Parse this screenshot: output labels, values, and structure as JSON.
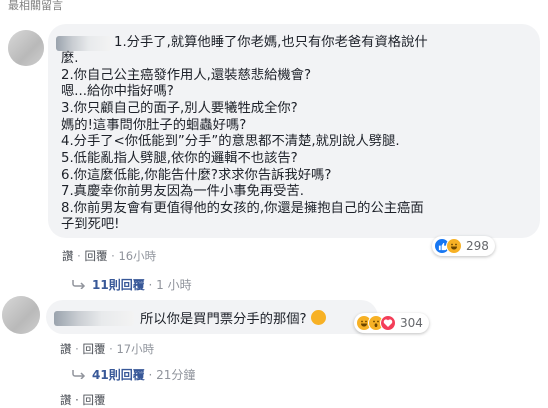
{
  "section_header": "最相關留言",
  "comments": [
    {
      "author": "",
      "lines": [
        "1.分手了,就算他睡了你老媽,也只有你老爸有資格說什",
        "麼.",
        "2.你自己公主癌發作用人,還裝慈悲給機會?",
        "嗯...給你中指好嗎?",
        "3.你只顧自己的面子,別人要犧牲成全你?",
        "媽的!這事問你肚子的蛔蟲好嗎?",
        "4.分手了<你低能到”分手”的意思都不清楚,就別說人劈腿.",
        "5.低能亂指人劈腿,依你的邏輯不也該告?",
        "6.你這麼低能,你能告什麼?求求你告訴我好嗎?",
        "7.真慶幸你前男友因為一件小事免再受苦.",
        "8.你前男友會有更值得他的女孩的,你還是擁抱自己的公主癌面",
        "子到死吧!"
      ],
      "reactions": {
        "icons": [
          "like-icon",
          "haha-icon"
        ],
        "count": "298"
      },
      "actions": {
        "like": "讚",
        "reply": "回覆",
        "time": "16小時"
      },
      "replies": {
        "text": "11則回覆",
        "time": "1 小時"
      }
    },
    {
      "author": "",
      "lines": [
        "所以你是買門票分手的那個?"
      ],
      "inline_emoji": "haha-emoji",
      "reactions": {
        "icons": [
          "haha-icon",
          "wow-icon",
          "love-icon"
        ],
        "count": "304"
      },
      "actions": {
        "like": "讚",
        "reply": "回覆",
        "time": "17小時"
      },
      "replies": {
        "text": "41則回覆",
        "time": "21分鐘"
      }
    }
  ],
  "footer_partial": "讚 · 回覆",
  "colors": {
    "bubble": "#f2f3f5",
    "link": "#385898",
    "like": "#1877f2",
    "haha": "#f7b125",
    "love": "#f33e58"
  }
}
